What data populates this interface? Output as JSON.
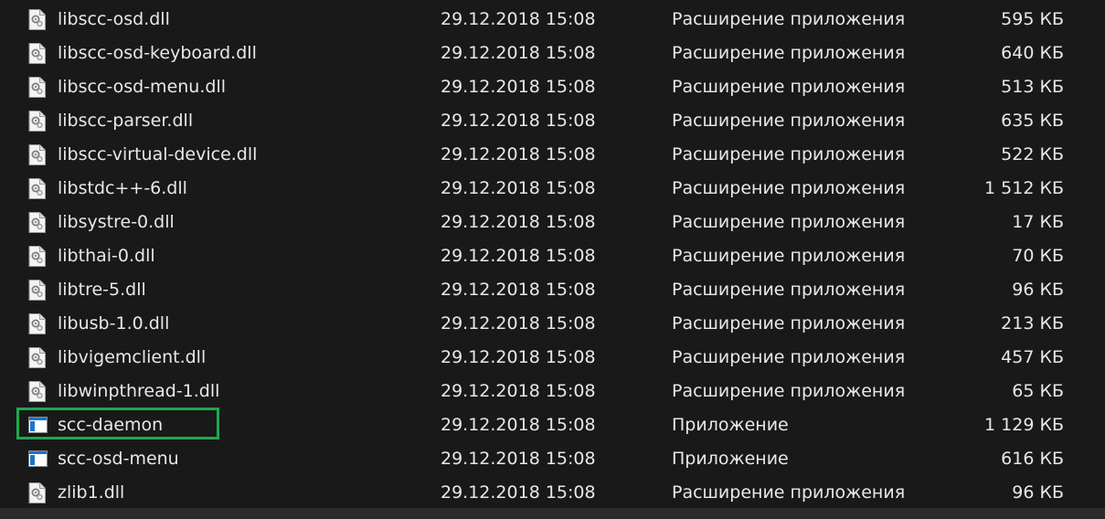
{
  "files": [
    {
      "name": "libscc-osd.dll",
      "date": "29.12.2018 15:08",
      "type": "Расширение приложения",
      "size": "595 КБ",
      "icon": "dll-file-icon"
    },
    {
      "name": "libscc-osd-keyboard.dll",
      "date": "29.12.2018 15:08",
      "type": "Расширение приложения",
      "size": "640 КБ",
      "icon": "dll-file-icon"
    },
    {
      "name": "libscc-osd-menu.dll",
      "date": "29.12.2018 15:08",
      "type": "Расширение приложения",
      "size": "513 КБ",
      "icon": "dll-file-icon"
    },
    {
      "name": "libscc-parser.dll",
      "date": "29.12.2018 15:08",
      "type": "Расширение приложения",
      "size": "635 КБ",
      "icon": "dll-file-icon"
    },
    {
      "name": "libscc-virtual-device.dll",
      "date": "29.12.2018 15:08",
      "type": "Расширение приложения",
      "size": "522 КБ",
      "icon": "dll-file-icon"
    },
    {
      "name": "libstdc++-6.dll",
      "date": "29.12.2018 15:08",
      "type": "Расширение приложения",
      "size": "1 512 КБ",
      "icon": "dll-file-icon"
    },
    {
      "name": "libsystre-0.dll",
      "date": "29.12.2018 15:08",
      "type": "Расширение приложения",
      "size": "17 КБ",
      "icon": "dll-file-icon"
    },
    {
      "name": "libthai-0.dll",
      "date": "29.12.2018 15:08",
      "type": "Расширение приложения",
      "size": "70 КБ",
      "icon": "dll-file-icon"
    },
    {
      "name": "libtre-5.dll",
      "date": "29.12.2018 15:08",
      "type": "Расширение приложения",
      "size": "96 КБ",
      "icon": "dll-file-icon"
    },
    {
      "name": "libusb-1.0.dll",
      "date": "29.12.2018 15:08",
      "type": "Расширение приложения",
      "size": "213 КБ",
      "icon": "dll-file-icon"
    },
    {
      "name": "libvigemclient.dll",
      "date": "29.12.2018 15:08",
      "type": "Расширение приложения",
      "size": "457 КБ",
      "icon": "dll-file-icon"
    },
    {
      "name": "libwinpthread-1.dll",
      "date": "29.12.2018 15:08",
      "type": "Расширение приложения",
      "size": "65 КБ",
      "icon": "dll-file-icon"
    },
    {
      "name": "scc-daemon",
      "date": "29.12.2018 15:08",
      "type": "Приложение",
      "size": "1 129 КБ",
      "icon": "application-icon",
      "highlighted": true
    },
    {
      "name": "scc-osd-menu",
      "date": "29.12.2018 15:08",
      "type": "Приложение",
      "size": "616 КБ",
      "icon": "application-icon"
    },
    {
      "name": "zlib1.dll",
      "date": "29.12.2018 15:08",
      "type": "Расширение приложения",
      "size": "96 КБ",
      "icon": "dll-file-icon"
    }
  ],
  "colors": {
    "background": "#191919",
    "text": "#e8e8e8",
    "highlight_border": "#1fa84f"
  }
}
